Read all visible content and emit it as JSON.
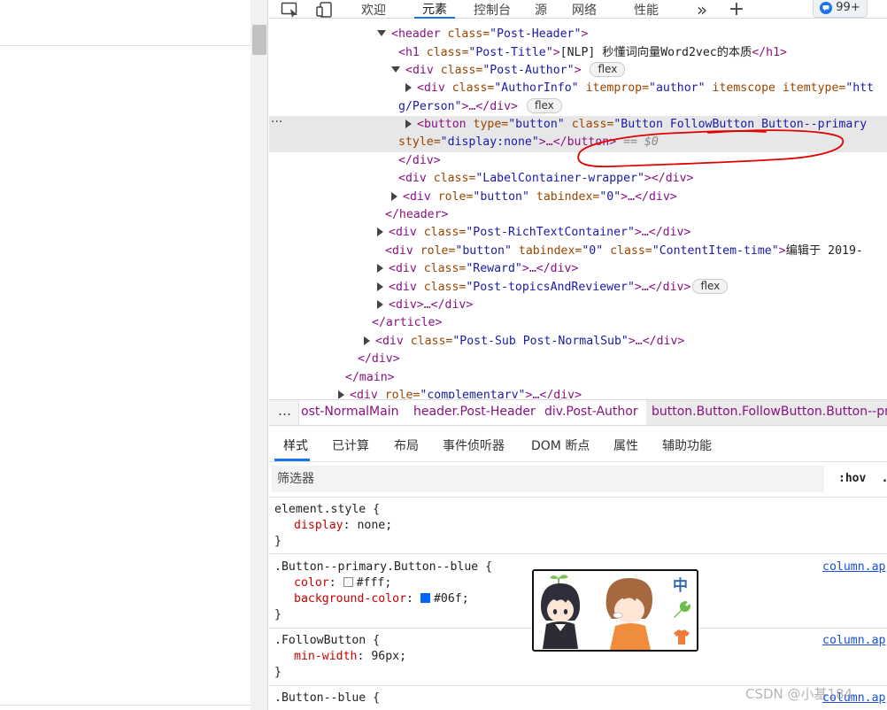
{
  "toolbar": {
    "tabs": [
      {
        "label": "欢迎"
      },
      {
        "label": "元素",
        "active": true
      },
      {
        "label": "控制台"
      },
      {
        "label": "源"
      },
      {
        "label": "网络"
      },
      {
        "label": "性能"
      }
    ],
    "more_label": "»",
    "add_label": "+",
    "badge_count": "99+"
  },
  "tree": {
    "gutter_dots": "···",
    "lines": {
      "header_open": {
        "tag": "<header ",
        "attr": "class=",
        "val": "\"Post-Header\"",
        "end": ">"
      },
      "h1": {
        "open": "<h1 ",
        "attr": "class=",
        "val": "\"Post-Title\"",
        "mid": ">",
        "text": "[NLP] 秒懂词向量Word2vec的本质",
        "close": "</h1>"
      },
      "author_div": {
        "open": "<div ",
        "attr": "class=",
        "val": "\"Post-Author\"",
        "end": ">",
        "pill": "flex"
      },
      "authorinfo": {
        "open": "<div ",
        "attr1": "class=",
        "val1": "\"AuthorInfo\"",
        "attr2": " itemprop=",
        "val2": "\"author\"",
        "attr3": " itemscope itemtype=",
        "val3": "\"htt"
      },
      "authorinfo_cont": {
        "val": "g/Person\"",
        "mid": ">…",
        "close": "</div>",
        "pill": "flex"
      },
      "button": {
        "open": "<button ",
        "attr1": "type=",
        "val1": "\"button\"",
        "attr2": " class=",
        "val2": "\"Button FollowButton Button--primary"
      },
      "button_cont": {
        "attr": "style=",
        "val": "\"display:none\"",
        "mid": ">…",
        "close": "</button>",
        "eq": " == $0"
      },
      "close_div": "</div>",
      "label_container": {
        "open": "<div ",
        "attr": "class=",
        "val": "\"LabelContainer-wrapper\"",
        "mid": ">",
        "close": "</div>"
      },
      "role_button": {
        "open": "<div ",
        "attr1": "role=",
        "val1": "\"button\"",
        "attr2": " tabindex=",
        "val2": "\"0\"",
        "mid": ">…",
        "close": "</div>"
      },
      "close_header": "</header>",
      "richtext": {
        "open": "<div ",
        "attr": "class=",
        "val": "\"Post-RichTextContainer\"",
        "mid": ">…",
        "close": "</div>"
      },
      "time": {
        "open": "<div ",
        "attr1": "role=",
        "val1": "\"button\"",
        "attr2": " tabindex=",
        "val2": "\"0\"",
        "attr3": " class=",
        "val3": "\"ContentItem-time\"",
        "mid": ">",
        "text": "编辑于 2019-"
      },
      "reward": {
        "open": "<div ",
        "attr": "class=",
        "val": "\"Reward\"",
        "mid": ">…",
        "close": "</div>"
      },
      "topics": {
        "open": "<div ",
        "attr": "class=",
        "val": "\"Post-topicsAndReviewer\"",
        "mid": ">…",
        "close": "</div>",
        "pill": "flex"
      },
      "anon_div": {
        "open": "<div>",
        "mid": "…",
        "close": "</div>"
      },
      "close_article": "</article>",
      "post_sub": {
        "open": "<div ",
        "attr": "class=",
        "val": "\"Post-Sub Post-NormalSub\"",
        "mid": ">…",
        "close": "</div>"
      },
      "close_div2": "</div>",
      "close_main": "</main>",
      "complementary": {
        "open": "<div ",
        "attr": "role=",
        "val": "\"complementary\"",
        "mid": ">…",
        "close": "</div>"
      }
    }
  },
  "breadcrumbs": {
    "more": "…",
    "items": [
      "ost-NormalMain",
      "header.Post-Header",
      "div.Post-Author",
      "button.Button.FollowButton.Button--prim"
    ]
  },
  "style_tabs": [
    "样式",
    "已计算",
    "布局",
    "事件侦听器",
    "DOM 断点",
    "属性",
    "辅助功能"
  ],
  "filter": {
    "placeholder": "筛选器",
    "hov": ":hov",
    "cls": "."
  },
  "rules": [
    {
      "selector": "element.style {",
      "decls": [
        {
          "prop": "display",
          "value": "none;"
        }
      ],
      "close": "}"
    },
    {
      "selector": ".Button--primary.Button--blue {",
      "source": "column.ap",
      "decls": [
        {
          "prop": "color",
          "value": "#fff;",
          "swatch": "#ffffff"
        },
        {
          "prop": "background-color",
          "value": "#06f;",
          "swatch": "#0066ff"
        }
      ],
      "close": "}"
    },
    {
      "selector": ".FollowButton {",
      "source": "column.ap",
      "decls": [
        {
          "prop": "min-width",
          "value": "96px;"
        }
      ],
      "close": "}"
    },
    {
      "selector": ".Button--blue {",
      "source": "column.ap"
    }
  ],
  "watermark": "CSDN @小基184",
  "colors": {
    "accent": "#1a73e8",
    "tag": "#881280",
    "attr": "#994500",
    "value": "#1a1aa6",
    "prop": "#c80000",
    "annotation": "#e00000"
  }
}
